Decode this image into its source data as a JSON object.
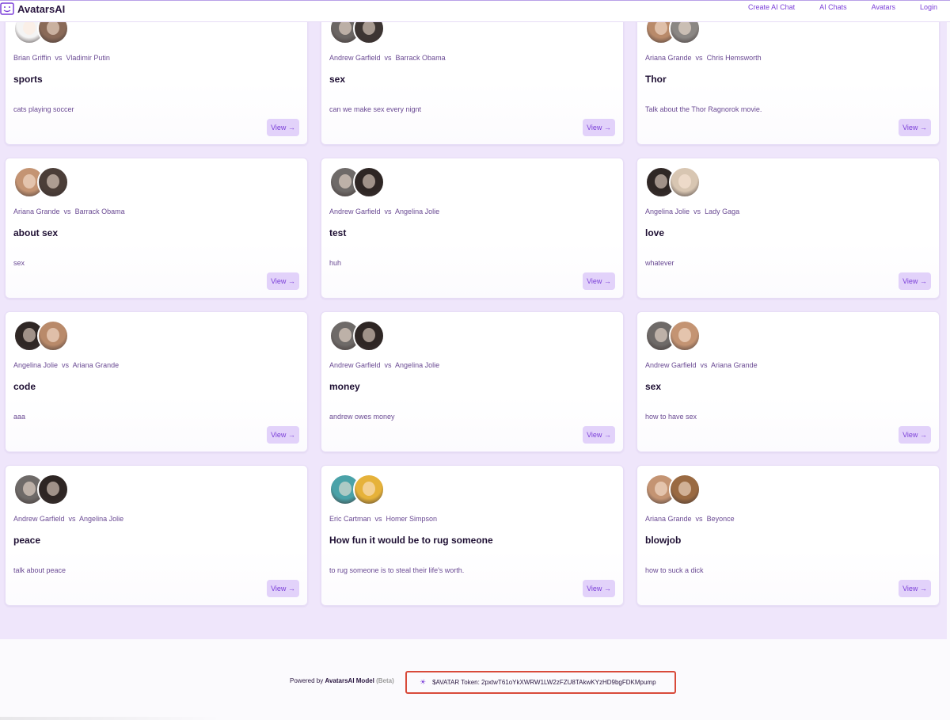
{
  "nav": {
    "brand": "AvatarsAI",
    "links": [
      "Create AI Chat",
      "AI Chats",
      "Avatars",
      "Login"
    ]
  },
  "cards": [
    {
      "a": "Brian Griffin",
      "b": "Vladimir Putin",
      "title": "sports",
      "desc": "cats playing soccer",
      "c1": "#f4f4f4",
      "c2": "#8a6a58"
    },
    {
      "a": "Andrew Garfield",
      "b": "Barrack Obama",
      "title": "sex",
      "desc": "can we make sex every nignt",
      "c1": "#6b6664",
      "c2": "#3d3533"
    },
    {
      "a": "Ariana Grande",
      "b": "Chris Hemsworth",
      "title": "Thor",
      "desc": "Talk about the Thor Ragnorok movie.",
      "c1": "#b98a6a",
      "c2": "#8b8784"
    },
    {
      "a": "Ariana Grande",
      "b": "Barrack Obama",
      "title": "about sex",
      "desc": "sex",
      "c1": "#c49473",
      "c2": "#4b3e38"
    },
    {
      "a": "Andrew Garfield",
      "b": "Angelina Jolie",
      "title": "test",
      "desc": "huh",
      "c1": "#6e6a68",
      "c2": "#2e2624"
    },
    {
      "a": "Angelina Jolie",
      "b": "Lady Gaga",
      "title": "love",
      "desc": "whatever",
      "c1": "#2f2725",
      "c2": "#d8c6b2"
    },
    {
      "a": "Angelina Jolie",
      "b": "Ariana Grande",
      "title": "code",
      "desc": "aaa",
      "c1": "#2f2725",
      "c2": "#b98a6a"
    },
    {
      "a": "Andrew Garfield",
      "b": "Angelina Jolie",
      "title": "money",
      "desc": "andrew owes money",
      "c1": "#6e6a68",
      "c2": "#2e2624"
    },
    {
      "a": "Andrew Garfield",
      "b": "Ariana Grande",
      "title": "sex",
      "desc": "how to have sex",
      "c1": "#6e6a68",
      "c2": "#c49473"
    },
    {
      "a": "Andrew Garfield",
      "b": "Angelina Jolie",
      "title": "peace",
      "desc": "talk about peace",
      "c1": "#6e6a68",
      "c2": "#2e2624"
    },
    {
      "a": "Eric Cartman",
      "b": "Homer Simpson",
      "title": "How fun it would be to rug someone",
      "desc": "to rug someone is to steal their life's worth.",
      "c1": "#4aa2a8",
      "c2": "#e6b23a"
    },
    {
      "a": "Ariana Grande",
      "b": "Beyonce",
      "title": "blowjob",
      "desc": "how to suck a dick",
      "c1": "#c49473",
      "c2": "#9a6a42"
    }
  ],
  "view_label": "View →",
  "vs": "vs",
  "footer": {
    "powered_prefix": "Powered by",
    "model": "AvatarsAI Model",
    "beta": "(Beta)",
    "token_text": "$AVATAR Token: 2pxtwT61oYkXWRW1LW2zFZU8TAkwKYzHD9bgFDKMpump"
  },
  "colors": {
    "accent": "#7b3fd8",
    "page_bg": "#efe6fb",
    "token_border": "#d84a3a"
  }
}
